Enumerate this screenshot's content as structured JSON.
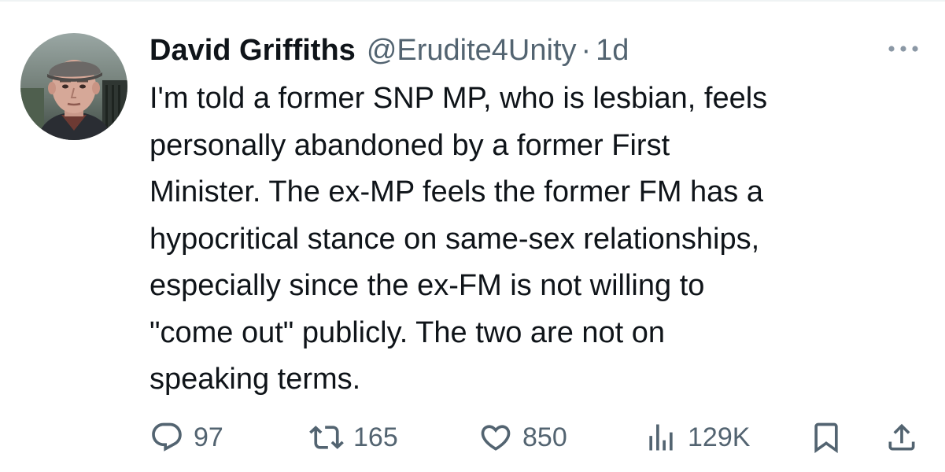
{
  "tweet": {
    "author": {
      "display_name": "David Griffiths",
      "handle": "@Erudite4Unity",
      "separator": "·",
      "timestamp": "1d"
    },
    "text_lines": [
      "I'm told a former SNP MP, who is lesbian, feels",
      "personally abandoned by a former First",
      "Minister. The ex-MP feels the former FM has a",
      "hypocritical stance on same-sex relationships,",
      "especially since the ex-FM is not willing to",
      "\"come out\" publicly. The two are not on",
      "speaking terms."
    ],
    "actions": {
      "replies": "97",
      "retweets": "165",
      "likes": "850",
      "views": "129K"
    }
  },
  "icons": {
    "more": "more-horizontal-icon",
    "reply": "speech-bubble-icon",
    "retweet": "retweet-arrows-icon",
    "like": "heart-icon",
    "views": "bar-chart-icon",
    "bookmark": "bookmark-icon",
    "share": "share-upload-icon"
  },
  "colors": {
    "text": "#0f1419",
    "secondary": "#536471",
    "divider": "#eff3f4"
  }
}
